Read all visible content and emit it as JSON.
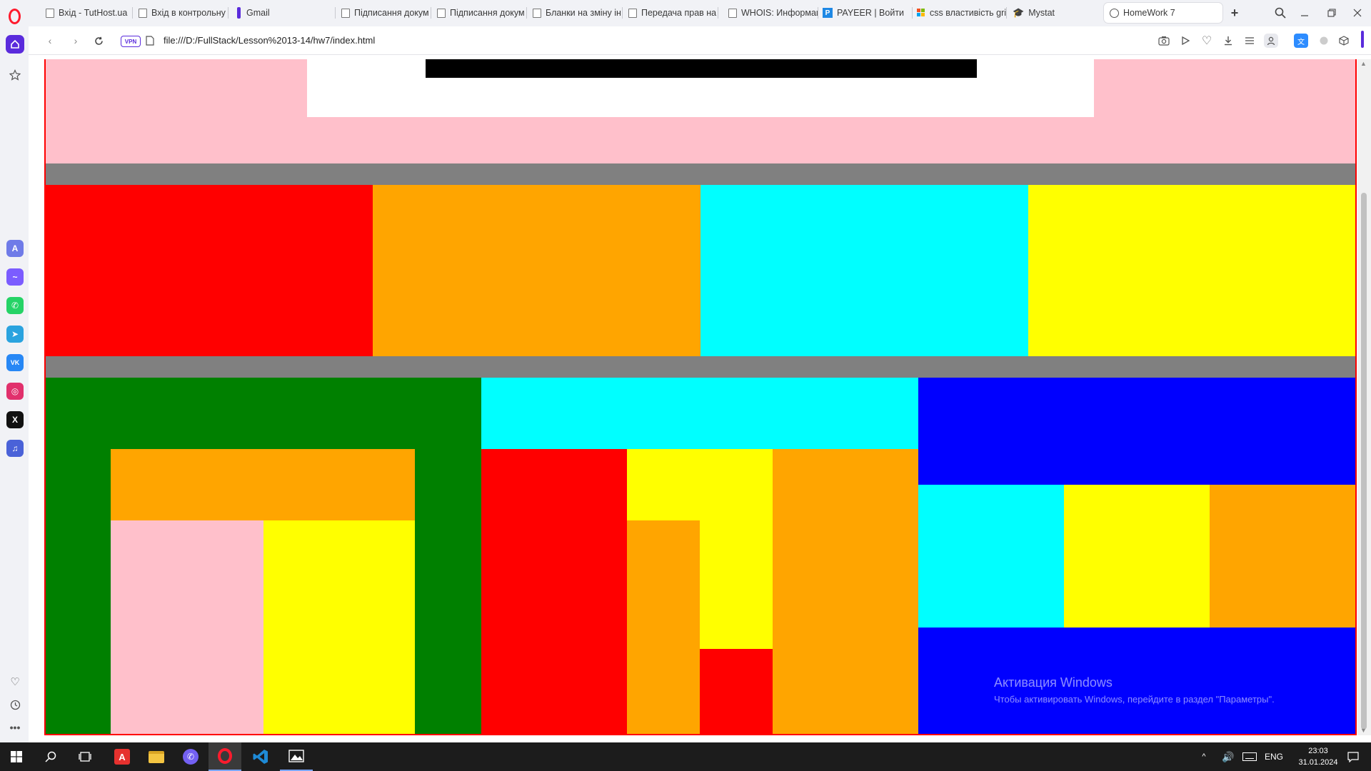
{
  "browser": {
    "tabs": [
      {
        "label": "Вхід - TutHost.ua"
      },
      {
        "label": "Вхід в контрольну"
      },
      {
        "label": "Gmail"
      },
      {
        "label": "Підписання докум"
      },
      {
        "label": "Підписання докум"
      },
      {
        "label": "Бланки на зміну ін"
      },
      {
        "label": "Передача прав на"
      },
      {
        "label": "WHOIS: Информац"
      },
      {
        "label": "PAYEER | Войти"
      },
      {
        "label": "css властивість gri"
      },
      {
        "label": "Mystat"
      },
      {
        "label": "HomeWork 7",
        "active": true
      }
    ],
    "new_tab_icon": "plus-icon",
    "vpn_label": "VPN",
    "url": "file:///D:/FullStack/Lesson%2013-14/hw7/index.html",
    "payeer_letter": "P"
  },
  "page": {
    "colors": {
      "pink": "#ffc0cb",
      "white": "#ffffff",
      "black": "#000000",
      "gray": "#808080",
      "red": "#ff0000",
      "orange": "#ffa500",
      "cyan": "#00ffff",
      "yellow": "#ffff00",
      "green": "#008000",
      "blue": "#0000ff",
      "border": "#ff0000"
    }
  },
  "watermark": {
    "title": "Активация Windows",
    "subtitle": "Чтобы активировать Windows, перейдите в раздел \"Параметры\"."
  },
  "taskbar": {
    "lang": "ENG",
    "time": "23:03",
    "date": "31.01.2024"
  }
}
